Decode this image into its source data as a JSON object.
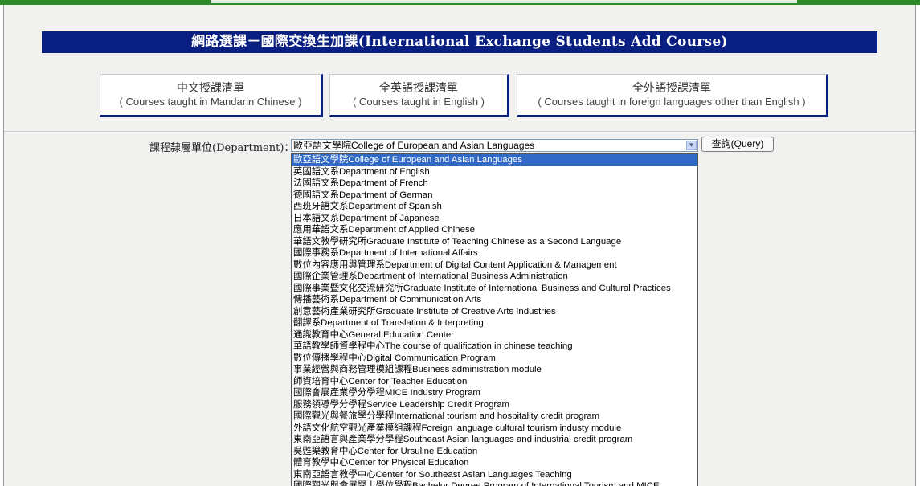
{
  "banner": {
    "title": "網路選課－國際交換生加課(International Exchange Students Add Course)"
  },
  "course_buttons": [
    {
      "zh": "中文授課清單",
      "en": "( Courses taught in Mandarin Chinese )"
    },
    {
      "zh": "全英語授課清單",
      "en": "( Courses taught in English )"
    },
    {
      "zh": "全外語授課清單",
      "en": "( Courses taught in foreign languages other than English )"
    }
  ],
  "department": {
    "label": "課程隸屬單位(Department)：",
    "selected": "歐亞語文學院College of European and Asian Languages",
    "query_label": "查詢(Query)",
    "options": [
      "歐亞語文學院College of European and Asian Languages",
      "英國語文系Department of English",
      "法國語文系Department of French",
      "德國語文系Department of German",
      "西班牙語文系Department of Spanish",
      "日本語文系Department of Japanese",
      "應用華語文系Department of Applied Chinese",
      "華語文教學研究所Graduate Institute of Teaching Chinese as a Second Language",
      "國際事務系Department of International Affairs",
      "數位內容應用與管理系Department of Digital Content Application & Management",
      "國際企業管理系Department of International Business Administration",
      "國際事業暨文化交流研究所Graduate Institute of International Business and Cultural Practices",
      "傳播藝術系Department of Communication Arts",
      "創意藝術產業研究所Graduate Institute of Creative Arts Industries",
      "翻譯系Department of Translation & Interpreting",
      "通識教育中心General Education Center",
      "華語教學師資學程中心The course of qualification in chinese teaching",
      "數位傳播學程中心Digital Communication Program",
      "事業經營與商務管理模組課程Business administration module",
      "師資培育中心Center for Teacher Education",
      "國際會展產業學分學程MICE Industry Program",
      "服務領導學分學程Service Leadership Credit Program",
      "國際觀光與餐旅學分學程International tourism and hospitality credit program",
      "外語文化航空觀光產業模組課程Foreign language cultural tourism industy module",
      "東南亞語言與產業學分學程Southeast Asian languages and industrial credit program",
      "吳甦樂教育中心Center for Ursuline Education",
      "體育教學中心Center for Physical Education",
      "東南亞語言教學中心Center for Southeast Asian Languages Teaching",
      "國際觀光與會展學士學位學程Bachelor Degree Program of International Tourism and MICE"
    ]
  },
  "icons": {
    "dropdown_arrow": "chevron-down-icon"
  },
  "colors": {
    "banner_bg": "#0a1f82",
    "selected_option": "#316ac5",
    "top_bar": "#2f8a2b"
  }
}
